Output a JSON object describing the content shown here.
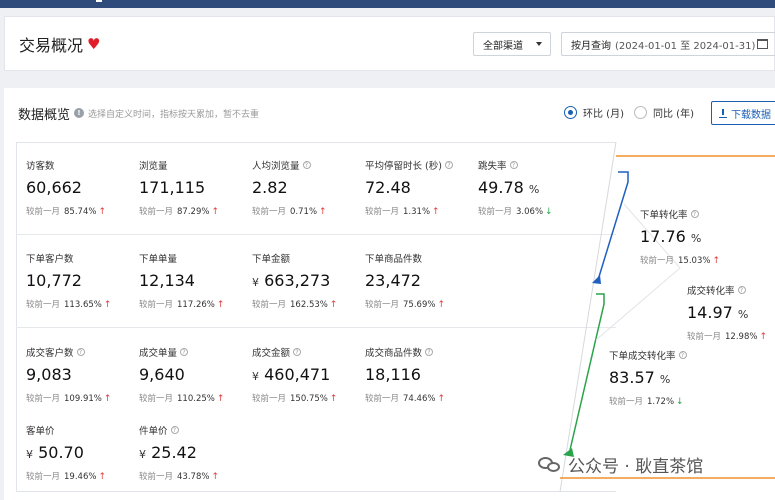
{
  "header": {
    "title": "交易概况",
    "channel_select": "全部渠道",
    "date_prefix": "按月查询",
    "date_range": "(2024-01-01 至 2024-01-31)"
  },
  "overview": {
    "title": "数据概览",
    "hint": "选择自定义时间，指标按天累加，暂不去重",
    "radio_mom": "环比 (月)",
    "radio_yoy": "同比 (年)",
    "download": "下载数据"
  },
  "compare_label": "较前一月",
  "metrics": {
    "visitors": {
      "label": "访客数",
      "value": "60,662",
      "pct": "85.74%",
      "trend": "up"
    },
    "pageviews": {
      "label": "浏览量",
      "value": "171,115",
      "pct": "87.29%",
      "trend": "up"
    },
    "avg_views": {
      "label": "人均浏览量",
      "value": "2.82",
      "pct": "0.71%",
      "trend": "up"
    },
    "avg_stay": {
      "label": "平均停留时长 (秒)",
      "value": "72.48",
      "pct": "1.31%",
      "trend": "up"
    },
    "bounce": {
      "label": "跳失率",
      "value": "49.78",
      "unit": "%",
      "pct": "3.06%",
      "trend": "down"
    },
    "order_customers": {
      "label": "下单客户数",
      "value": "10,772",
      "pct": "113.65%",
      "trend": "up"
    },
    "orders": {
      "label": "下单单量",
      "value": "12,134",
      "pct": "117.26%",
      "trend": "up"
    },
    "order_amount": {
      "label": "下单金额",
      "currency": "¥",
      "value": "663,273",
      "pct": "162.53%",
      "trend": "up"
    },
    "order_items": {
      "label": "下单商品件数",
      "value": "23,472",
      "pct": "75.69%",
      "trend": "up"
    },
    "deal_customers": {
      "label": "成交客户数",
      "value": "9,083",
      "pct": "109.91%",
      "trend": "up"
    },
    "deal_orders": {
      "label": "成交单量",
      "value": "9,640",
      "pct": "110.25%",
      "trend": "up"
    },
    "deal_amount": {
      "label": "成交金额",
      "currency": "¥",
      "value": "460,471",
      "pct": "150.75%",
      "trend": "up"
    },
    "deal_items": {
      "label": "成交商品件数",
      "value": "18,116",
      "pct": "74.46%",
      "trend": "up"
    },
    "avg_order_value": {
      "label": "客单价",
      "currency": "¥",
      "value": "50.70",
      "pct": "19.46%",
      "trend": "up"
    },
    "avg_item_price": {
      "label": "件单价",
      "currency": "¥",
      "value": "25.42",
      "pct": "43.78%",
      "trend": "up"
    },
    "order_conversion": {
      "label": "下单转化率",
      "value": "17.76",
      "unit": "%",
      "pct": "15.03%",
      "trend": "up"
    },
    "deal_conversion": {
      "label": "成交转化率",
      "value": "14.97",
      "unit": "%",
      "pct": "12.98%",
      "trend": "up"
    },
    "order_to_deal": {
      "label": "下单成交转化率",
      "value": "83.57",
      "unit": "%",
      "pct": "1.72%",
      "trend": "down"
    }
  },
  "icons": {
    "up": "↑",
    "down": "↓",
    "info": "!",
    "help": "?",
    "heart": "♥"
  },
  "watermark": "公众号 · 耿直茶馆",
  "colors": {
    "accent": "#1a5fb4",
    "up": "#e03a3a",
    "down": "#2aa44a",
    "flow_blue": "#1f5fbf",
    "flow_green": "#2aa44a",
    "flow_orange": "#f0922b"
  }
}
